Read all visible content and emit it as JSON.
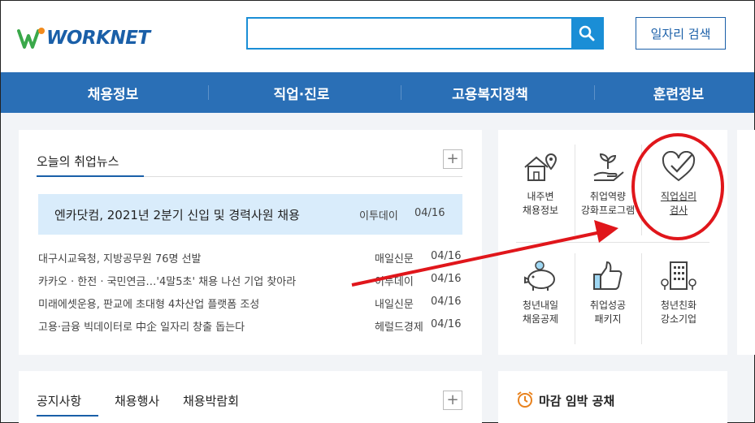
{
  "header": {
    "logo_text": "WORKNET",
    "search_placeholder": "",
    "job_search_label": "일자리 검색"
  },
  "nav": {
    "items": [
      "채용정보",
      "직업·진로",
      "고용복지정책",
      "훈련정보"
    ]
  },
  "news": {
    "tab_label": "오늘의 취업뉴스",
    "headline": {
      "title": "엔카닷컴, 2021년 2분기 신입 및 경력사원 채용",
      "source": "이투데이",
      "date": "04/16"
    },
    "rows": [
      {
        "title": "대구시교육청, 지방공무원 76명 선발",
        "source": "매일신문",
        "date": "04/16"
      },
      {
        "title": "카카오 · 한전 · 국민연금…'4말5초' 채용 나선 기업 찾아라",
        "source": "이투데이",
        "date": "04/16"
      },
      {
        "title": "미래에셋운용, 판교에 초대형 4차산업 플랫폼 조성",
        "source": "내일신문",
        "date": "04/16"
      },
      {
        "title": "고용·금융 빅데이터로 中企 일자리 창출 돕는다",
        "source": "헤럴드경제",
        "date": "04/16"
      }
    ]
  },
  "services": [
    {
      "line1": "내주변",
      "line2": "채용정보",
      "icon": "house-location-icon"
    },
    {
      "line1": "취업역량",
      "line2": "강화프로그램",
      "icon": "plant-hand-icon"
    },
    {
      "line1": "직업심리",
      "line2": "검사",
      "icon": "heart-check-icon"
    },
    {
      "line1": "청년내일",
      "line2": "채움공제",
      "icon": "piggy-bank-icon"
    },
    {
      "line1": "취업성공",
      "line2": "패키지",
      "icon": "thumbs-up-icon"
    },
    {
      "line1": "청년친화",
      "line2": "강소기업",
      "icon": "building-icon"
    }
  ],
  "notice": {
    "tabs": [
      "공지사항",
      "채용행사",
      "채용박람회"
    ]
  },
  "deadline": {
    "title": "마감 임박 공채",
    "icon": "alarm-clock-icon"
  },
  "colors": {
    "brand_blue": "#2a6fb6",
    "accent_blue": "#1a8ed6",
    "highlight_bg": "#d9ecfb",
    "annotation_red": "#e0161b"
  }
}
